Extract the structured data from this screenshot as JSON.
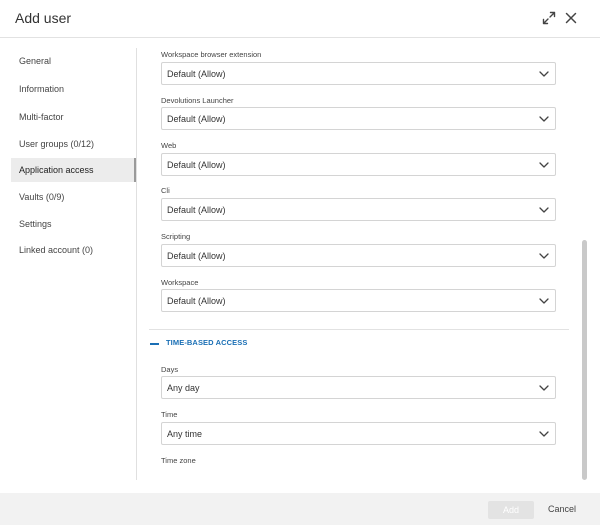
{
  "dialog": {
    "title": "Add user",
    "expand_icon": "expand-arrows-icon",
    "close_icon": "close-x-icon"
  },
  "sidebar": {
    "items": [
      {
        "label": "General"
      },
      {
        "label": "Information"
      },
      {
        "label": "Multi-factor"
      },
      {
        "label": "User groups (0/12)"
      },
      {
        "label": "Application access",
        "active": true
      },
      {
        "label": "Vaults (0/9)"
      },
      {
        "label": "Settings"
      },
      {
        "label": "Linked account (0)"
      }
    ]
  },
  "application_access": {
    "fields": [
      {
        "label": "Workspace browser extension",
        "value": "Default (Allow)"
      },
      {
        "label": "Devolutions Launcher",
        "value": "Default (Allow)"
      },
      {
        "label": "Web",
        "value": "Default (Allow)"
      },
      {
        "label": "Cli",
        "value": "Default (Allow)"
      },
      {
        "label": "Scripting",
        "value": "Default (Allow)"
      },
      {
        "label": "Workspace",
        "value": "Default (Allow)"
      }
    ]
  },
  "time_based_access": {
    "title": "TIME-BASED ACCESS",
    "days": {
      "label": "Days",
      "value": "Any day"
    },
    "time": {
      "label": "Time",
      "value": "Any time"
    },
    "timezone": {
      "label": "Time zone"
    }
  },
  "footer": {
    "add_label": "Add",
    "cancel_label": "Cancel"
  },
  "colors": {
    "accent": "#1a6fb5",
    "active_nav_bg": "#ececec",
    "footer_bg": "#f2f2f2",
    "disabled_button": "#e3e3e3"
  }
}
